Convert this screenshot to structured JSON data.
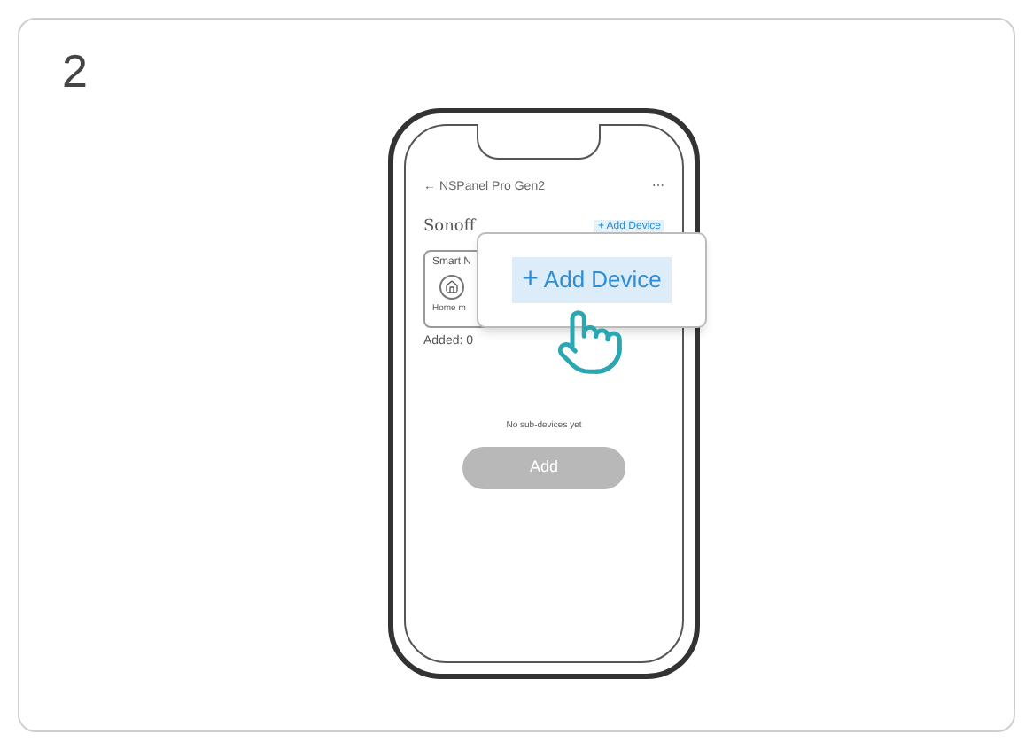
{
  "step": "2",
  "phone": {
    "back": "←",
    "title": "NSPanel Pro Gen2",
    "menu_icon_text": "⋯",
    "brand": "Sonoff",
    "add_link": "+ Add Device",
    "card": {
      "title": "Smart N",
      "item_label": "Home m"
    },
    "added": "Added: 0",
    "empty_text": "No sub-devices yet",
    "add_button": {
      "label": "Add",
      "disabled": true
    }
  },
  "callout": {
    "plus": "+",
    "label": "Add Device"
  }
}
